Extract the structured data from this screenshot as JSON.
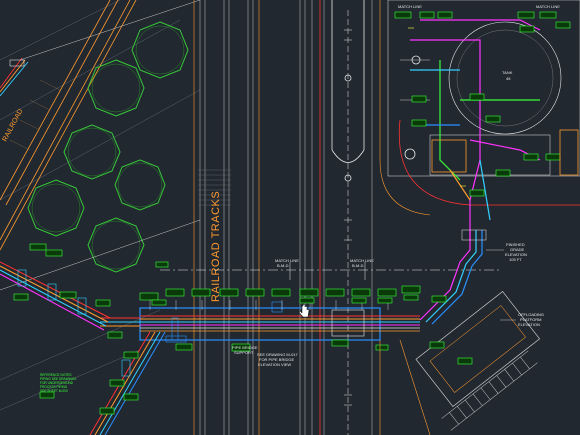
{
  "labels": {
    "railroad_main": "RAILROAD TRACKS",
    "railroad_left": "RAILROAD",
    "tank": "TANK",
    "tank_no": "45",
    "match_line_a": "MATCH LINE",
    "match_line_a_ref": "B-M-D",
    "match_line_b": "MATCH LINE",
    "match_line_b_ref": "B-M-D",
    "match_line_top": "MATCH LINE",
    "match_line_top_ref": "B-M-D",
    "match_line_top2": "MATCH LINE",
    "match_line_top2_ref": "B-M-D",
    "elevation_1": "FINISHED",
    "elevation_2": "GRADE",
    "elevation_3": "ELEVATION",
    "elevation_4": "105 FT",
    "platform_1": "OFFLOADING",
    "platform_2": "PLATFORM",
    "platform_3": "ELEVATION",
    "see_dwg_1": "SEE DRAWING M-017",
    "see_dwg_2": "FOR PIPE BRIDGE",
    "see_dwg_3": "ELEVATION VIEW",
    "bridge_note_1": "PIPE BRIDGE",
    "bridge_note_2": "SUPPORT",
    "notes": [
      "REFERENCE NOTES",
      "PIPING SEE DRAWINGS",
      "FOR UNDERGROUND",
      "PROCESS PIPING",
      "SEE SHEET M-000"
    ]
  },
  "colors": {
    "background": "#212830",
    "orange": "#ff9a2e",
    "green": "#39ff39",
    "magenta": "#ff33ff",
    "cyan": "#33d0ff",
    "red": "#ff3333",
    "white": "#e6e6e6",
    "yellow": "#ffff33"
  }
}
